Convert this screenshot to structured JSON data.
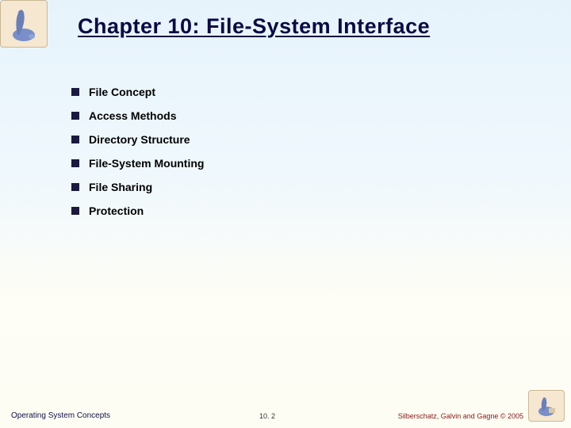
{
  "title": "Chapter 10:  File-System Interface",
  "bullets": [
    "File Concept",
    "Access Methods",
    "Directory Structure",
    "File-System Mounting",
    "File Sharing",
    "Protection"
  ],
  "footer": {
    "left": "Operating System Concepts",
    "center": "10. 2",
    "right": "Silberschatz, Galvin and Gagne © 2005"
  },
  "art": {
    "top_left": "dinosaur-illustration",
    "bottom_right": "dinosaur-illustration-small"
  }
}
